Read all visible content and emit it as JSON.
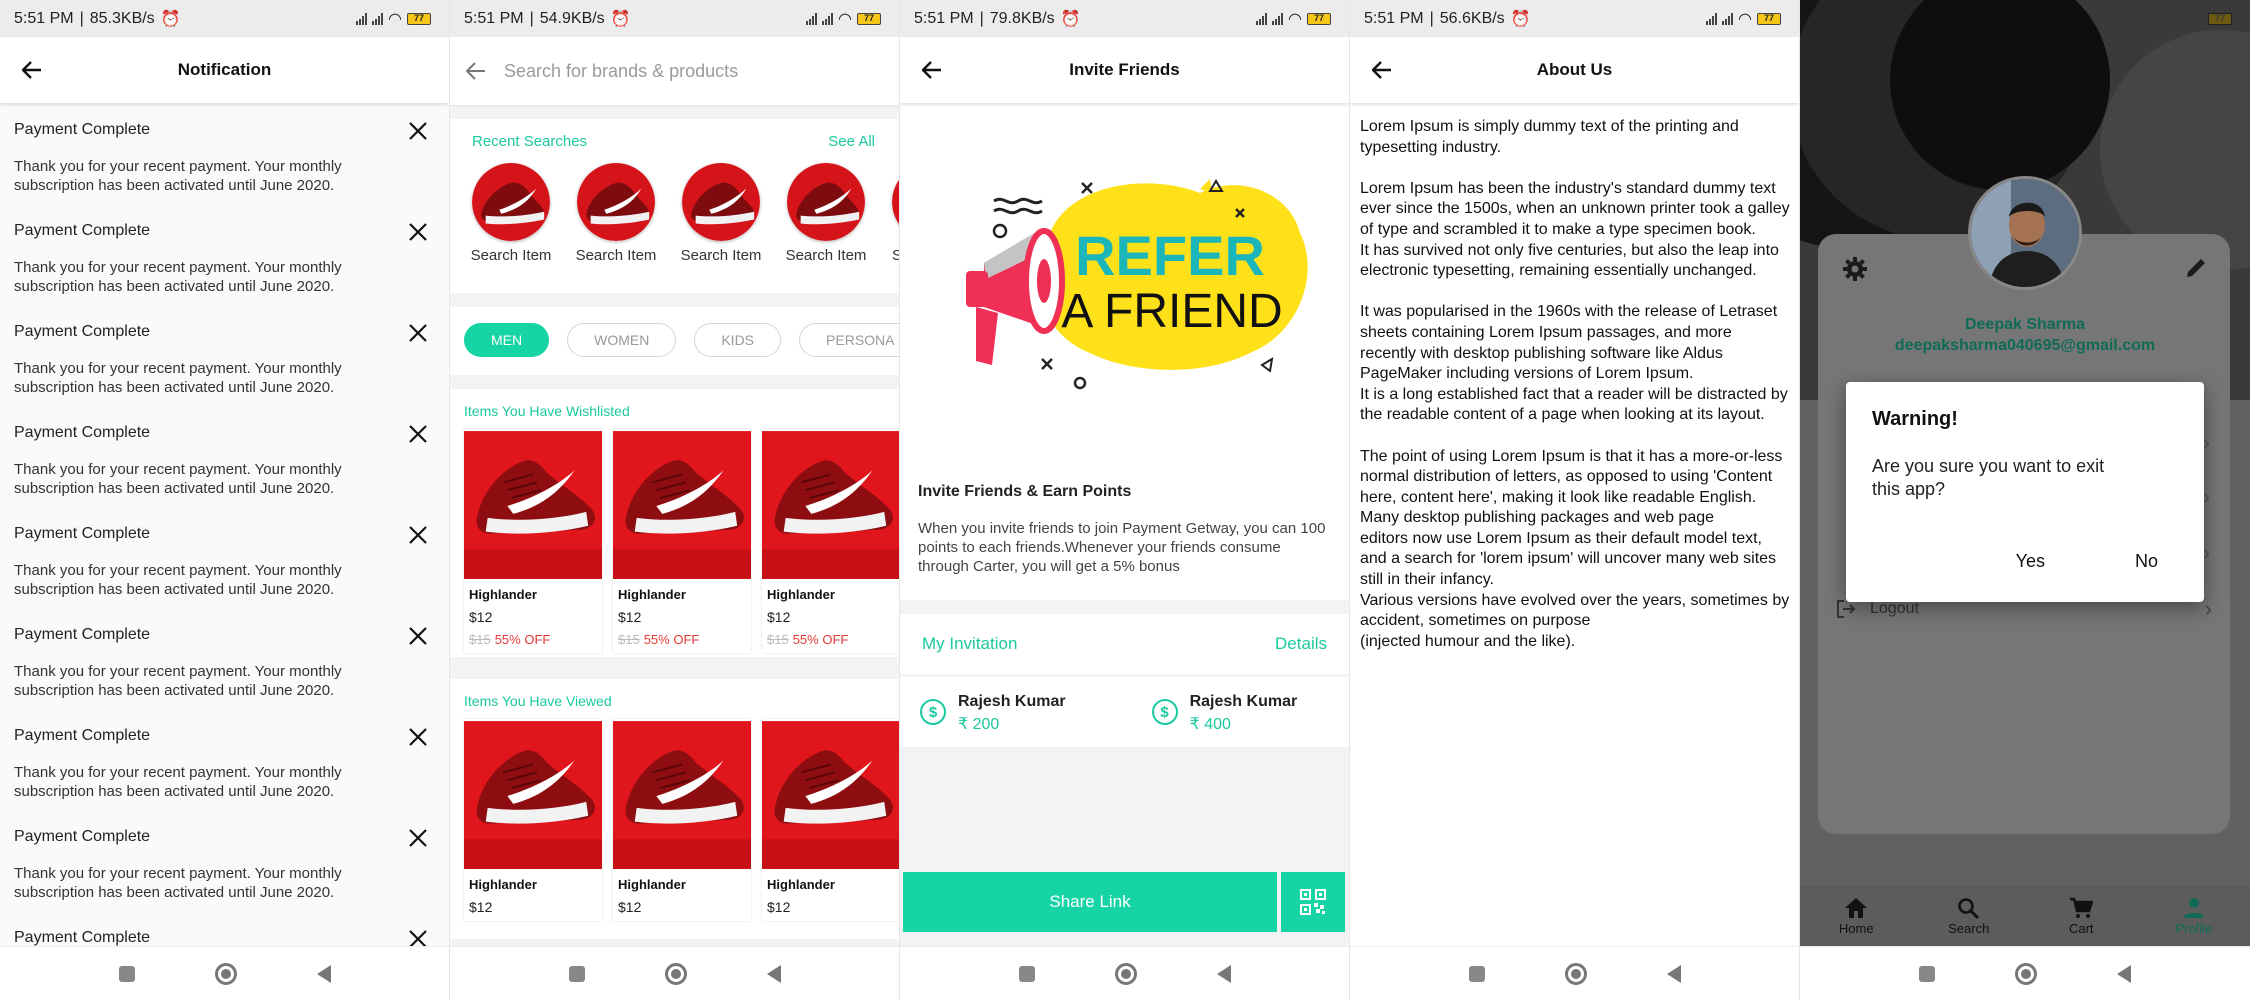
{
  "colors": {
    "accent": "#16d4a5",
    "accent_text": "#1bc9a0",
    "discount": "#e53935"
  },
  "screens": {
    "notification": {
      "status": {
        "time": "5:51 PM",
        "speed": "85.3KB/s",
        "battery": "77"
      },
      "title": "Notification",
      "items": [
        {
          "title": "Payment Complete",
          "body": "Thank you for your recent payment. Your monthly subscription has been activated until June 2020."
        },
        {
          "title": "Payment Complete",
          "body": "Thank you for your recent payment. Your monthly subscription has been activated until June 2020."
        },
        {
          "title": "Payment Complete",
          "body": "Thank you for your recent payment. Your monthly subscription has been activated until June 2020."
        },
        {
          "title": "Payment Complete",
          "body": "Thank you for your recent payment. Your monthly subscription has been activated until June 2020."
        },
        {
          "title": "Payment Complete",
          "body": "Thank you for your recent payment. Your monthly subscription has been activated until June 2020."
        },
        {
          "title": "Payment Complete",
          "body": "Thank you for your recent payment. Your monthly subscription has been activated until June 2020."
        },
        {
          "title": "Payment Complete",
          "body": "Thank you for your recent payment. Your monthly subscription has been activated until June 2020."
        },
        {
          "title": "Payment Complete",
          "body": "Thank you for your recent payment. Your monthly subscription has been activated until June 2020."
        },
        {
          "title": "Payment Complete",
          "body": ""
        }
      ]
    },
    "search": {
      "status": {
        "time": "5:51 PM",
        "speed": "54.9KB/s",
        "battery": "77"
      },
      "placeholder": "Search for brands & products",
      "recent_title": "Recent Searches",
      "see_all": "See All",
      "recent_items": [
        "Search Item",
        "Search Item",
        "Search Item",
        "Search Item",
        "Se"
      ],
      "chips": [
        "MEN",
        "WOMEN",
        "KIDS",
        "PERSONA"
      ],
      "wishlist_title": "Items You Have Wishlisted",
      "viewed_title": "Items You Have Viewed",
      "products": [
        {
          "name": "Highlander",
          "price": "$12",
          "old_price": "$15",
          "discount": "55% OFF"
        },
        {
          "name": "Highlander",
          "price": "$12",
          "old_price": "$15",
          "discount": "55% OFF"
        },
        {
          "name": "Highlander",
          "price": "$12",
          "old_price": "$15",
          "discount": "55% OFF"
        }
      ],
      "viewed_products": [
        {
          "name": "Highlander",
          "price": "$12"
        },
        {
          "name": "Highlander",
          "price": "$12"
        },
        {
          "name": "Highlander",
          "price": "$12"
        }
      ]
    },
    "invite": {
      "status": {
        "time": "5:51 PM",
        "speed": "79.8KB/s",
        "battery": "77"
      },
      "title": "Invite Friends",
      "banner_line1": "REFER",
      "banner_line2": "A FRIEND",
      "heading": "Invite Friends & Earn Points",
      "description": "When you invite friends to join Payment Getway, you can 100 points to each friends.Whenever your friends consume through Carter, you will get a 5% bonus",
      "my_invitation": "My Invitation",
      "details": "Details",
      "invitees": [
        {
          "name": "Rajesh Kumar",
          "amount": "₹ 200"
        },
        {
          "name": "Rajesh Kumar",
          "amount": "₹ 400"
        }
      ],
      "share_label": "Share Link"
    },
    "about": {
      "status": {
        "time": "5:51 PM",
        "speed": "56.6KB/s",
        "battery": "77"
      },
      "title": "About Us",
      "body": "Lorem Ipsum is simply dummy text of the printing and typesetting industry.\n\nLorem Ipsum has been the industry's standard dummy text ever since the 1500s, when an unknown printer took a galley of type and scrambled it to make a type specimen book.\nIt has survived not only five centuries, but also the leap into electronic typesetting, remaining essentially unchanged.\n\nIt was popularised in the 1960s with the release of Letraset sheets containing Lorem Ipsum passages, and more recently with desktop publishing software like Aldus PageMaker including versions of Lorem Ipsum.\nIt is a long established fact that a reader will be distracted by the readable content of a page when looking at its layout.\n\nThe point of using Lorem Ipsum is that it has a more-or-less normal distribution of letters, as opposed to using 'Content here, content here', making it look like readable English. Many desktop publishing packages and web page\neditors now use Lorem Ipsum as their default model text, and a search for 'lorem ipsum' will uncover many web sites still in their infancy.\n Various versions have evolved over the years, sometimes by accident, sometimes on purpose\n (injected humour and the like)."
    },
    "profile": {
      "status": {
        "battery": "77"
      },
      "name": "Deepak Sharma",
      "email": "deepaksharma040695@gmail.com",
      "logout": "Logout",
      "dialog": {
        "title": "Warning!",
        "message": "Are you sure you want to exit this app?",
        "yes": "Yes",
        "no": "No"
      },
      "tabs": [
        {
          "label": "Home",
          "icon": "home-icon"
        },
        {
          "label": "Search",
          "icon": "search-icon"
        },
        {
          "label": "Cart",
          "icon": "cart-icon"
        },
        {
          "label": "Profile",
          "icon": "person-icon"
        }
      ]
    }
  }
}
